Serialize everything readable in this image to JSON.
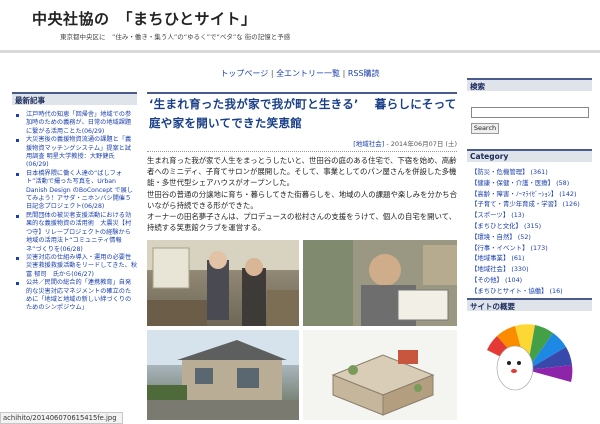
{
  "header": {
    "title": "中央社協の　「まちひとサイト」",
    "description": "東京都中央区に　”住み・働き・集う人”の“ゆるく”で“ベタ”な 街の記憶と予感"
  },
  "topnav": {
    "items": [
      "トップページ",
      "全エントリー一覧",
      "RSS購読"
    ],
    "separator": " | "
  },
  "left_sidebar": {
    "heading": "最新記事",
    "items": [
      {
        "text": "江戸時代の知恵「回帰舎」地域での参加時のための義務が、日常の地域課題に繋がる活用ことた",
        "date": "(06/29)"
      },
      {
        "text": "大災害後の義援物資流通の課題と「義援物資マッチングシステム」提案と試用調査 明星大学教授：大野健氏",
        "date": "(06/29)"
      },
      {
        "text": "日本橋界隈に働く人達の“ばしフォト”活動で撮った写真を、Urban Danish Design のBoConcept で展してみよう！アサダ・ニホンバシ開催５日記念プロジェクト",
        "date": "(06/28)"
      },
      {
        "text": "民間団体の被災者支援活動における効果的な義援物資の活用術　大震災【村つ守】リレープロジェクトの経験から　地域の活用法ト“コミュニティ情報ネ”づくりを",
        "date": "(06/28)"
      },
      {
        "text": "災害対応の仕組み導入・運用の必要性　災害救援救援活動をリードしてきた、秋富 郁司　氏から",
        "date": "(06/27)"
      },
      {
        "text": "公共／民間の総合的「連携教育」自発的な災害対応マネジメントの確立のために「地域と地域の新しい絆づくりのためのシンポジウム」",
        "date": ""
      }
    ]
  },
  "post": {
    "title": "‘生まれ育った我が家で我が町と生きる’　 暮らしにそって庭や家を開いてできた笑恵館",
    "category": "[地域社会]",
    "date": " - 2014年06月07日 (土)",
    "paragraphs": [
      "生まれ育った我が家で人生をまっとうしたいと、世田谷の庭のある住宅で、下宿を始め、高齢者へのミニディ、子育てサロンが展開した。そして、事業としてのパン屋さんを併設した多機能・多世代型シェアハウスがオープンした。",
      "世田谷の普通の分譲地に育ち・暮らしてきた街暮らしを、地域の人の課題や楽しみを分かち合いながら持続できる形ができた。",
      "オーナーの田名夢子さんは、プロデュースの松村さんの支援をうけて、個人の自宅を開いて、持続する笑恵館クラブを運営する。"
    ]
  },
  "right_sidebar": {
    "search_heading": "検索",
    "search_button": "Search",
    "search_value": "",
    "category_heading": "Category",
    "categories": [
      "【防災・危機管理】 (361)",
      "【健康・保健・介護・医療】 (58)",
      "【高齢・障害・ﾉｰﾏﾗｲｾﾞｰｼｮﾝ】 (142)",
      "【子育て・青少年育成・学習】 (126)",
      "【スポーツ】 (13)",
      "【まちひと文化】 (315)",
      "【環境・自然】 (52)",
      "【行事・イベント】 (173)",
      "【地域事業】 (61)",
      "【地域社会】 (330)",
      "【その他】 (104)",
      "【まちひとサイト・協働】 (16)"
    ],
    "about_heading": "サイトの概要"
  },
  "status_bar": {
    "url": "achihito/201406070615415fe.jpg"
  },
  "colors": {
    "link": "#1a3fb0",
    "heading_bar": "#4a5a8c",
    "title": "#1a3f8a"
  }
}
